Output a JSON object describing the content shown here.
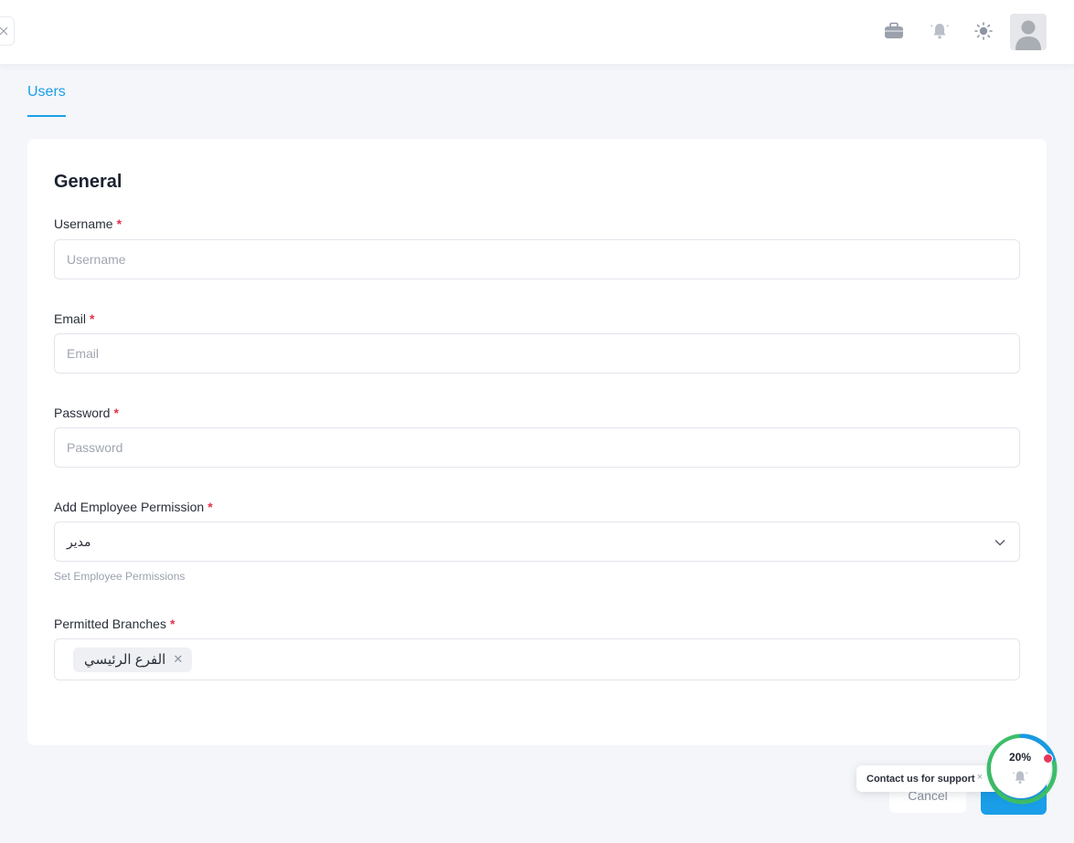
{
  "header": {
    "icons": [
      "briefcase-icon",
      "bell-icon",
      "sun-icon"
    ],
    "avatar": "user-avatar"
  },
  "tabs": [
    {
      "label": "Users",
      "active": true
    }
  ],
  "form": {
    "section_title": "General",
    "username": {
      "label": "Username",
      "placeholder": "Username",
      "value": ""
    },
    "email": {
      "label": "Email",
      "placeholder": "Email",
      "value": ""
    },
    "password": {
      "label": "Password",
      "placeholder": "Password",
      "value": ""
    },
    "permission": {
      "label": "Add Employee Permission",
      "selected": "مدير",
      "hint": "Set Employee Permissions"
    },
    "branches": {
      "label": "Permitted Branches",
      "selected": [
        "الفرع الرئيسي"
      ]
    },
    "required_mark": "*"
  },
  "footer": {
    "cancel_label": "Cancel",
    "save_label": ""
  },
  "support": {
    "tooltip": "Contact us for support",
    "close": "×",
    "progress_label": "20%",
    "progress": 0.2
  },
  "colors": {
    "accent": "#1a9ee8",
    "required": "#e5334d",
    "progress_green": "#3ec36b",
    "notification_dot": "#e8375a"
  }
}
